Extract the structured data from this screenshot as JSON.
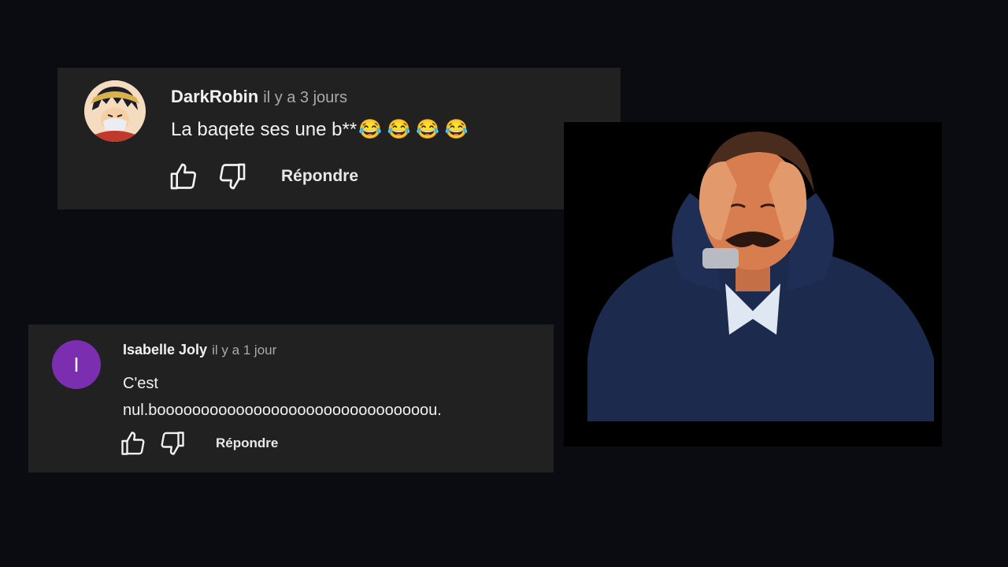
{
  "comments": [
    {
      "author": "DarkRobin",
      "time": "il y a 3 jours",
      "text": "La baqete ses une b**",
      "emojis": "😂 😂 😂 😂",
      "reply_label": "Répondre"
    },
    {
      "author": "Isabelle Joly",
      "time": "il y a 1 jour",
      "avatar_letter": "I",
      "text_line1": "C'est",
      "text_line2": "nul.booooooooooooooooooooooooooooooou.",
      "reply_label": "Répondre"
    }
  ],
  "colors": {
    "background": "#0b0c11",
    "card": "#212121",
    "avatar_purple": "#7b2fb0"
  },
  "icons": [
    "like-icon",
    "dislike-icon"
  ]
}
